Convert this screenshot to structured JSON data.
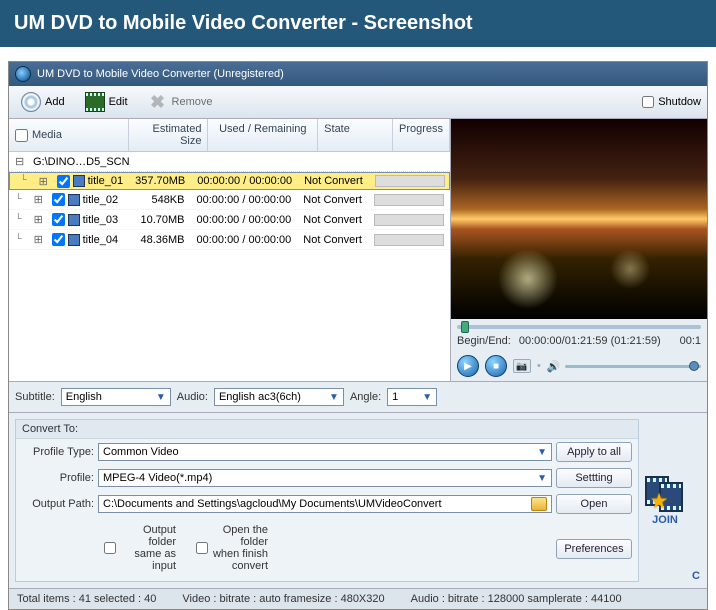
{
  "banner": "UM DVD to Mobile Video Converter - Screenshot",
  "titlebar": "UM DVD to Mobile Video Converter  (Unregistered)",
  "toolbar": {
    "add": "Add",
    "edit": "Edit",
    "remove": "Remove",
    "shutdown": "Shutdow"
  },
  "grid": {
    "headers": {
      "media": "Media",
      "size": "Estimated Size",
      "time": "Used / Remaining",
      "state": "State",
      "progress": "Progress"
    },
    "group": "G:\\DINO…D5_SCN",
    "rows": [
      {
        "title": "title_01",
        "size": "357.70MB",
        "time": "00:00:00 / 00:00:00",
        "state": "Not Convert",
        "sel": true
      },
      {
        "title": "title_02",
        "size": "548KB",
        "time": "00:00:00 / 00:00:00",
        "state": "Not Convert",
        "sel": false
      },
      {
        "title": "title_03",
        "size": "10.70MB",
        "time": "00:00:00 / 00:00:00",
        "state": "Not Convert",
        "sel": false
      },
      {
        "title": "title_04",
        "size": "48.36MB",
        "time": "00:00:00 / 00:00:00",
        "state": "Not Convert",
        "sel": false
      }
    ]
  },
  "time": {
    "label": "Begin/End:",
    "range": "00:00:00/01:21:59 (01:21:59)",
    "pos": "00:1"
  },
  "mid": {
    "subtitle_label": "Subtitle:",
    "subtitle": "English",
    "audio_label": "Audio:",
    "audio": "English ac3(6ch)",
    "angle_label": "Angle:",
    "angle": "1"
  },
  "convert": {
    "title": "Convert To:",
    "ptype_label": "Profile Type:",
    "ptype": "Common Video",
    "profile_label": "Profile:",
    "profile": "MPEG-4 Video(*.mp4)",
    "out_label": "Output Path:",
    "out": "C:\\Documents and Settings\\agcloud\\My Documents\\UMVideoConvert",
    "same": "Output folder same as input",
    "openf": "Open the folder when finish convert",
    "apply": "Apply to all",
    "setting": "Settting",
    "open": "Open",
    "prefs": "Preferences"
  },
  "actions": {
    "join": "JOIN",
    "c": "C"
  },
  "status": {
    "items": "Total items : 41  selected : 40",
    "video": "Video : bitrate : auto  framesize : 480X320",
    "audio": "Audio : bitrate : 128000  samplerate : 44100"
  }
}
